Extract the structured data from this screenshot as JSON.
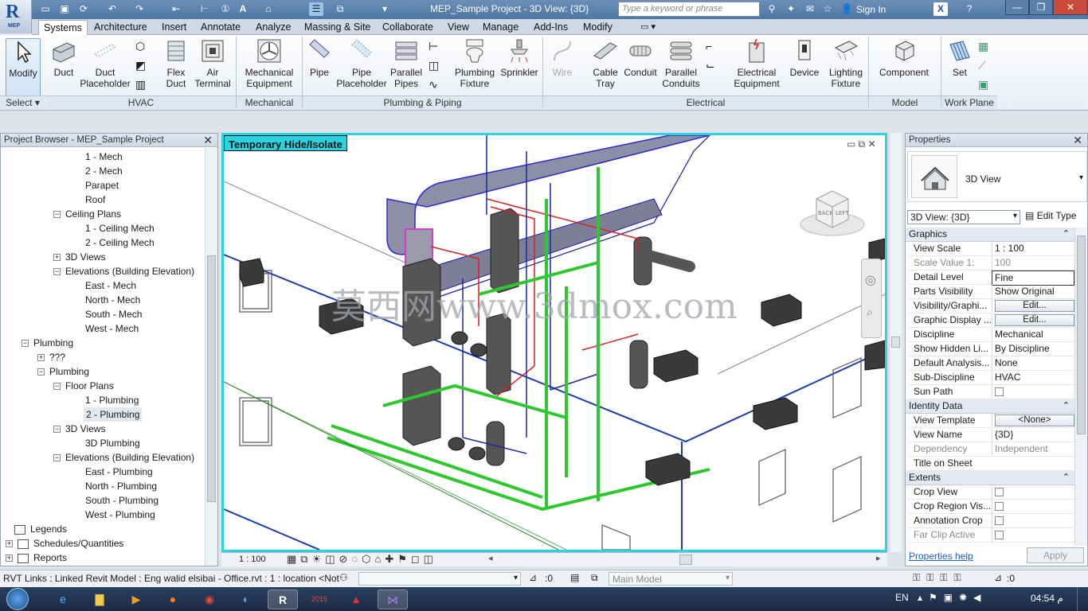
{
  "app": {
    "title": "MEP_Sample Project - 3D View: {3D}",
    "search_placeholder": "Type a keyword or phrase",
    "sign_in": "Sign In",
    "logo_text": "MEP"
  },
  "tabs": [
    "Systems",
    "Architecture",
    "Insert",
    "Annotate",
    "Analyze",
    "Massing & Site",
    "Collaborate",
    "View",
    "Manage",
    "Add-Ins",
    "Modify"
  ],
  "ribbon": {
    "buttons": {
      "modify": "Modify",
      "duct": "Duct",
      "duct_placeholder_1": "Duct",
      "duct_placeholder_2": "Placeholder",
      "flex_duct_1": "Flex",
      "flex_duct_2": "Duct",
      "air_terminal_1": "Air",
      "air_terminal_2": "Terminal",
      "mech_equip_1": "Mechanical",
      "mech_equip_2": "Equipment",
      "pipe": "Pipe",
      "pipe_placeholder_1": "Pipe",
      "pipe_placeholder_2": "Placeholder",
      "parallel_pipes_1": "Parallel",
      "parallel_pipes_2": "Pipes",
      "plumbing_fixture_1": "Plumbing",
      "plumbing_fixture_2": "Fixture",
      "sprinkler": "Sprinkler",
      "wire": "Wire",
      "cable_tray_1": "Cable",
      "cable_tray_2": "Tray",
      "conduit": "Conduit",
      "parallel_conduits_1": "Parallel",
      "parallel_conduits_2": "Conduits",
      "elec_equip_1": "Electrical",
      "elec_equip_2": "Equipment",
      "device": "Device",
      "lighting_fixture_1": "Lighting",
      "lighting_fixture_2": "Fixture",
      "component": "Component",
      "set": "Set"
    },
    "panels": {
      "select": "Select",
      "hvac": "HVAC",
      "mechanical": "Mechanical",
      "plumbing": "Plumbing & Piping",
      "electrical": "Electrical",
      "model": "Model",
      "work_plane": "Work Plane"
    }
  },
  "project_browser": {
    "header": "Project Browser - MEP_Sample Project",
    "rows": [
      {
        "label": "1 - Mech"
      },
      {
        "label": "2 - Mech"
      },
      {
        "label": "Parapet"
      },
      {
        "label": "Roof"
      },
      {
        "label": "Ceiling Plans"
      },
      {
        "label": "1 - Ceiling Mech"
      },
      {
        "label": "2 - Ceiling Mech"
      },
      {
        "label": "3D Views"
      },
      {
        "label": "Elevations (Building Elevation)"
      },
      {
        "label": "East - Mech"
      },
      {
        "label": "North - Mech"
      },
      {
        "label": "South - Mech"
      },
      {
        "label": "West - Mech"
      },
      {
        "label": "Plumbing"
      },
      {
        "label": "???"
      },
      {
        "label": "Plumbing"
      },
      {
        "label": "Floor Plans"
      },
      {
        "label": "1 - Plumbing"
      },
      {
        "label": "2 - Plumbing"
      },
      {
        "label": "3D Views"
      },
      {
        "label": "3D Plumbing"
      },
      {
        "label": "Elevations (Building Elevation)"
      },
      {
        "label": "East - Plumbing"
      },
      {
        "label": "North - Plumbing"
      },
      {
        "label": "South - Plumbing"
      },
      {
        "label": "West - Plumbing"
      },
      {
        "label": "Legends"
      },
      {
        "label": "Schedules/Quantities"
      },
      {
        "label": "Reports"
      }
    ]
  },
  "view": {
    "tag": "Temporary Hide/Isolate",
    "watermark": "莫西网www.3dmox.com",
    "scale": "1 : 100",
    "cube_back": "BACK",
    "cube_left": "LEFT"
  },
  "properties": {
    "header": "Properties",
    "type_name": "3D View",
    "selector": "3D View: {3D}",
    "edit_type": "Edit Type",
    "groups": {
      "graphics": "Graphics",
      "identity": "Identity Data",
      "extents": "Extents"
    },
    "graphics": [
      {
        "k": "View Scale",
        "v": "1 : 100"
      },
      {
        "k": "Scale Value    1:",
        "v": "100"
      },
      {
        "k": "Detail Level",
        "v": "Fine"
      },
      {
        "k": "Parts Visibility",
        "v": "Show Original"
      },
      {
        "k": "Visibility/Graphi...",
        "v": "Edit..."
      },
      {
        "k": "Graphic Display ...",
        "v": "Edit..."
      },
      {
        "k": "Discipline",
        "v": "Mechanical"
      },
      {
        "k": "Show Hidden Li...",
        "v": "By Discipline"
      },
      {
        "k": "Default Analysis...",
        "v": "None"
      },
      {
        "k": "Sub-Discipline",
        "v": "HVAC"
      },
      {
        "k": "Sun Path",
        "v": ""
      }
    ],
    "identity": [
      {
        "k": "View Template",
        "v": "<None>"
      },
      {
        "k": "View Name",
        "v": "{3D}"
      },
      {
        "k": "Dependency",
        "v": "Independent"
      },
      {
        "k": "Title on Sheet",
        "v": ""
      }
    ],
    "extents": [
      {
        "k": "Crop View",
        "v": ""
      },
      {
        "k": "Crop Region Vis...",
        "v": ""
      },
      {
        "k": "Annotation Crop",
        "v": ""
      },
      {
        "k": "Far Clip Active",
        "v": ""
      }
    ],
    "help": "Properties help",
    "apply": "Apply"
  },
  "status": {
    "text": "RVT Links : Linked Revit Model : Eng walid elsibai - Office.rvt : 1 : location <Not",
    "filter": ":0",
    "model": "Main Model",
    "sel_count": ":0"
  },
  "taskbar": {
    "lang": "EN",
    "time": "04:54 م",
    "revit_label": "2015"
  }
}
